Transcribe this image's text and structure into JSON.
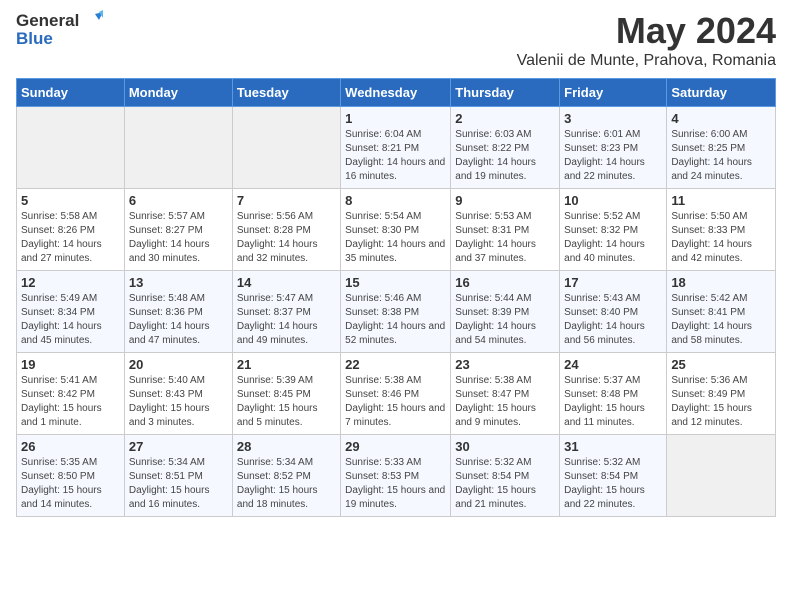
{
  "header": {
    "logo_general": "General",
    "logo_blue": "Blue",
    "title": "May 2024",
    "subtitle": "Valenii de Munte, Prahova, Romania"
  },
  "weekdays": [
    "Sunday",
    "Monday",
    "Tuesday",
    "Wednesday",
    "Thursday",
    "Friday",
    "Saturday"
  ],
  "weeks": [
    [
      {
        "day": "",
        "info": ""
      },
      {
        "day": "",
        "info": ""
      },
      {
        "day": "",
        "info": ""
      },
      {
        "day": "1",
        "info": "Sunrise: 6:04 AM\nSunset: 8:21 PM\nDaylight: 14 hours and 16 minutes."
      },
      {
        "day": "2",
        "info": "Sunrise: 6:03 AM\nSunset: 8:22 PM\nDaylight: 14 hours and 19 minutes."
      },
      {
        "day": "3",
        "info": "Sunrise: 6:01 AM\nSunset: 8:23 PM\nDaylight: 14 hours and 22 minutes."
      },
      {
        "day": "4",
        "info": "Sunrise: 6:00 AM\nSunset: 8:25 PM\nDaylight: 14 hours and 24 minutes."
      }
    ],
    [
      {
        "day": "5",
        "info": "Sunrise: 5:58 AM\nSunset: 8:26 PM\nDaylight: 14 hours and 27 minutes."
      },
      {
        "day": "6",
        "info": "Sunrise: 5:57 AM\nSunset: 8:27 PM\nDaylight: 14 hours and 30 minutes."
      },
      {
        "day": "7",
        "info": "Sunrise: 5:56 AM\nSunset: 8:28 PM\nDaylight: 14 hours and 32 minutes."
      },
      {
        "day": "8",
        "info": "Sunrise: 5:54 AM\nSunset: 8:30 PM\nDaylight: 14 hours and 35 minutes."
      },
      {
        "day": "9",
        "info": "Sunrise: 5:53 AM\nSunset: 8:31 PM\nDaylight: 14 hours and 37 minutes."
      },
      {
        "day": "10",
        "info": "Sunrise: 5:52 AM\nSunset: 8:32 PM\nDaylight: 14 hours and 40 minutes."
      },
      {
        "day": "11",
        "info": "Sunrise: 5:50 AM\nSunset: 8:33 PM\nDaylight: 14 hours and 42 minutes."
      }
    ],
    [
      {
        "day": "12",
        "info": "Sunrise: 5:49 AM\nSunset: 8:34 PM\nDaylight: 14 hours and 45 minutes."
      },
      {
        "day": "13",
        "info": "Sunrise: 5:48 AM\nSunset: 8:36 PM\nDaylight: 14 hours and 47 minutes."
      },
      {
        "day": "14",
        "info": "Sunrise: 5:47 AM\nSunset: 8:37 PM\nDaylight: 14 hours and 49 minutes."
      },
      {
        "day": "15",
        "info": "Sunrise: 5:46 AM\nSunset: 8:38 PM\nDaylight: 14 hours and 52 minutes."
      },
      {
        "day": "16",
        "info": "Sunrise: 5:44 AM\nSunset: 8:39 PM\nDaylight: 14 hours and 54 minutes."
      },
      {
        "day": "17",
        "info": "Sunrise: 5:43 AM\nSunset: 8:40 PM\nDaylight: 14 hours and 56 minutes."
      },
      {
        "day": "18",
        "info": "Sunrise: 5:42 AM\nSunset: 8:41 PM\nDaylight: 14 hours and 58 minutes."
      }
    ],
    [
      {
        "day": "19",
        "info": "Sunrise: 5:41 AM\nSunset: 8:42 PM\nDaylight: 15 hours and 1 minute."
      },
      {
        "day": "20",
        "info": "Sunrise: 5:40 AM\nSunset: 8:43 PM\nDaylight: 15 hours and 3 minutes."
      },
      {
        "day": "21",
        "info": "Sunrise: 5:39 AM\nSunset: 8:45 PM\nDaylight: 15 hours and 5 minutes."
      },
      {
        "day": "22",
        "info": "Sunrise: 5:38 AM\nSunset: 8:46 PM\nDaylight: 15 hours and 7 minutes."
      },
      {
        "day": "23",
        "info": "Sunrise: 5:38 AM\nSunset: 8:47 PM\nDaylight: 15 hours and 9 minutes."
      },
      {
        "day": "24",
        "info": "Sunrise: 5:37 AM\nSunset: 8:48 PM\nDaylight: 15 hours and 11 minutes."
      },
      {
        "day": "25",
        "info": "Sunrise: 5:36 AM\nSunset: 8:49 PM\nDaylight: 15 hours and 12 minutes."
      }
    ],
    [
      {
        "day": "26",
        "info": "Sunrise: 5:35 AM\nSunset: 8:50 PM\nDaylight: 15 hours and 14 minutes."
      },
      {
        "day": "27",
        "info": "Sunrise: 5:34 AM\nSunset: 8:51 PM\nDaylight: 15 hours and 16 minutes."
      },
      {
        "day": "28",
        "info": "Sunrise: 5:34 AM\nSunset: 8:52 PM\nDaylight: 15 hours and 18 minutes."
      },
      {
        "day": "29",
        "info": "Sunrise: 5:33 AM\nSunset: 8:53 PM\nDaylight: 15 hours and 19 minutes."
      },
      {
        "day": "30",
        "info": "Sunrise: 5:32 AM\nSunset: 8:54 PM\nDaylight: 15 hours and 21 minutes."
      },
      {
        "day": "31",
        "info": "Sunrise: 5:32 AM\nSunset: 8:54 PM\nDaylight: 15 hours and 22 minutes."
      },
      {
        "day": "",
        "info": ""
      }
    ]
  ]
}
